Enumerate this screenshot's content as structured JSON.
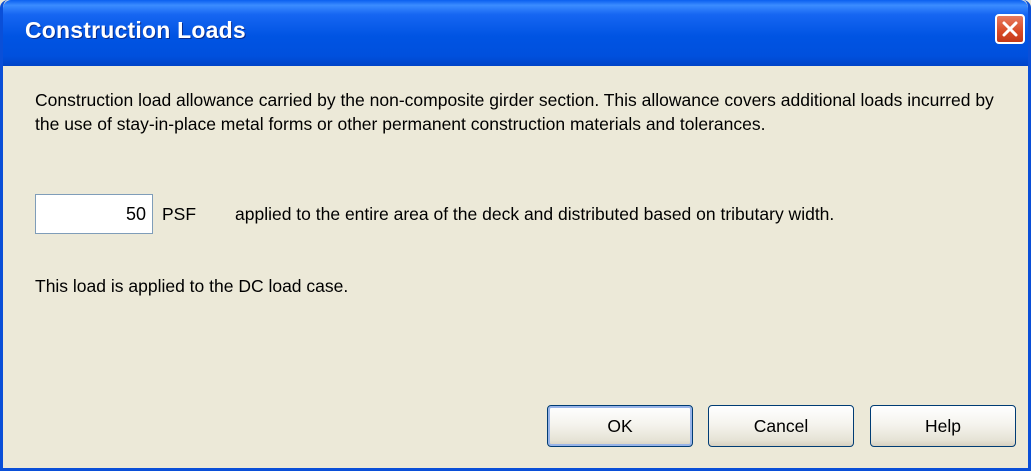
{
  "window": {
    "title": "Construction Loads"
  },
  "body": {
    "description": "Construction load allowance carried by the non-composite girder section. This allowance covers additional loads incurred by the use of stay-in-place metal forms or other permanent construction materials and tolerances.",
    "load_value": "50",
    "unit": "PSF",
    "applied_text": "applied to the entire area of the deck and distributed based on tributary width.",
    "dc_note": "This load is applied to the DC load case."
  },
  "buttons": {
    "ok": "OK",
    "cancel": "Cancel",
    "help": "Help"
  },
  "icons": {
    "close": "close-icon"
  },
  "colors": {
    "titlebar": "#0054e3",
    "close_button": "#d84a25",
    "dialog_background": "#ece9d8",
    "input_border": "#7f9db9"
  }
}
